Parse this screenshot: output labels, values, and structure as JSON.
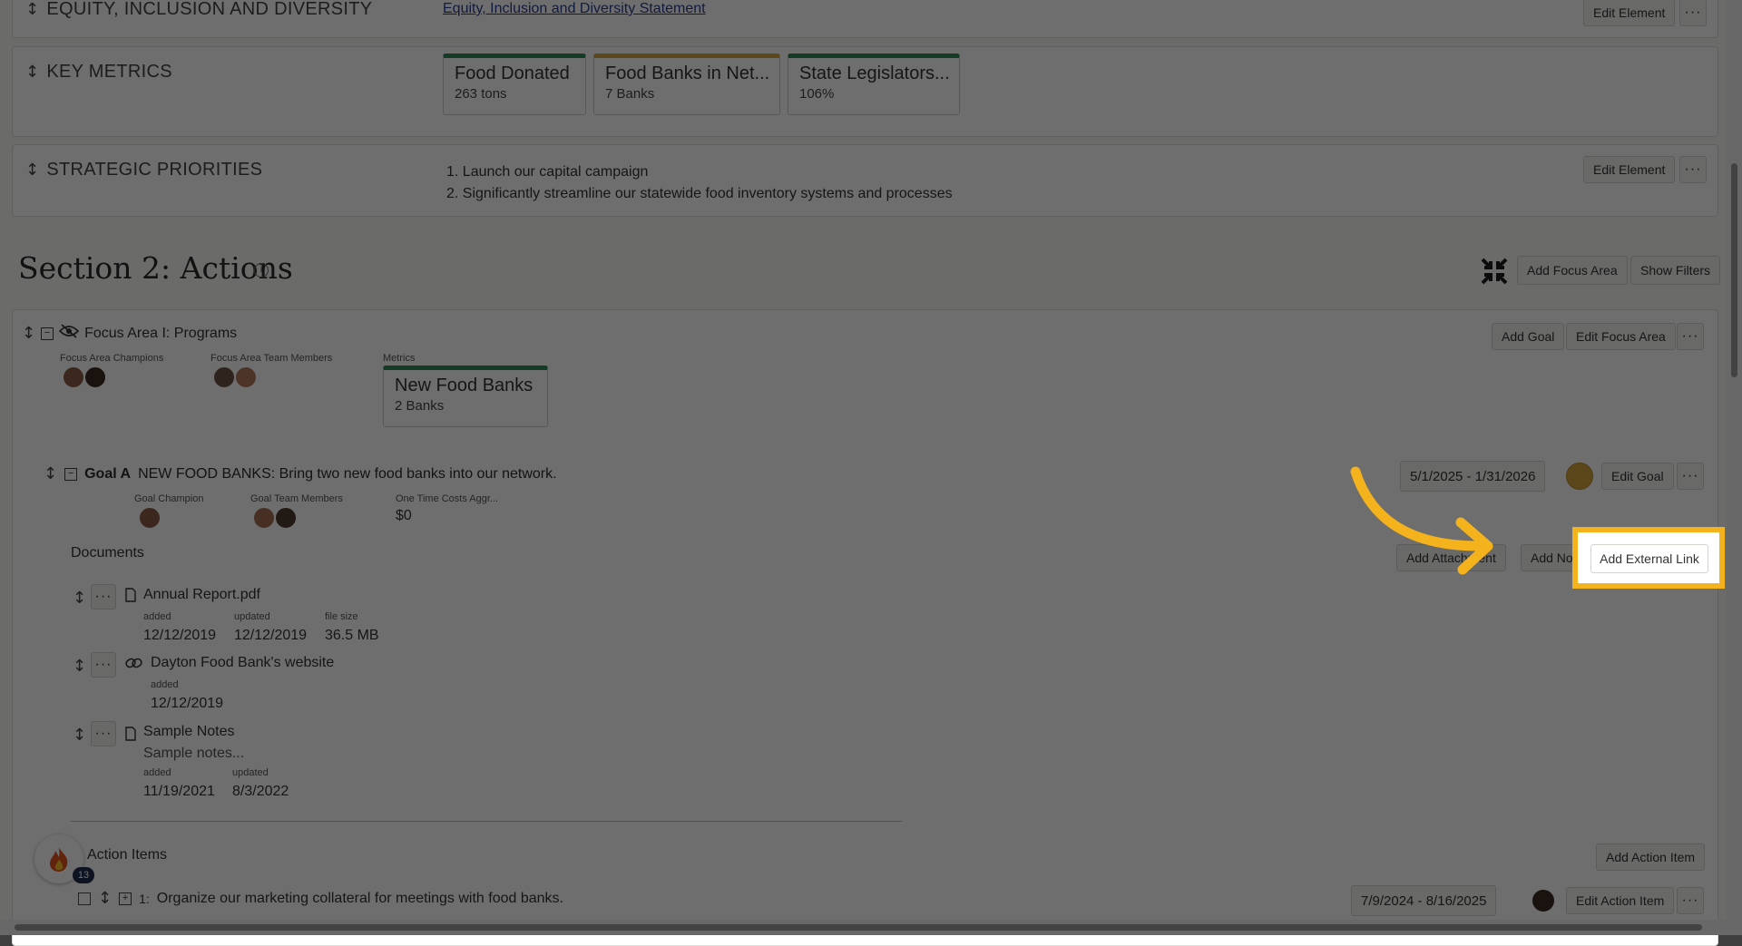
{
  "equity": {
    "label": "EQUITY, INCLUSION AND DIVERSITY",
    "link": "Equity, Inclusion and Diversity Statement",
    "edit": "Edit Element",
    "more": "···"
  },
  "metrics": {
    "label": "KEY METRICS",
    "cards": [
      {
        "title": "Food Donated",
        "value": "263 tons",
        "color": "#2e8b57"
      },
      {
        "title": "Food Banks in Net...",
        "value": "7 Banks",
        "color": "#d4a53a"
      },
      {
        "title": "State Legislators...",
        "value": "106%",
        "color": "#2e8b57"
      }
    ]
  },
  "priorities": {
    "label": "STRATEGIC PRIORITIES",
    "items": [
      "1. Launch our capital campaign",
      "2. Significantly streamline our statewide food inventory systems and processes"
    ],
    "edit": "Edit Element",
    "more": "···"
  },
  "section2": {
    "title": "Section 2: Actions",
    "add_focus": "Add Focus Area",
    "show_filters": "Show Filters"
  },
  "focus": {
    "title": "Focus Area I: Programs",
    "champions_label": "Focus Area Champions",
    "team_label": "Focus Area Team Members",
    "metrics_label": "Metrics",
    "metric_card": {
      "title": "New Food Banks",
      "value": "2 Banks"
    },
    "add_goal": "Add Goal",
    "edit_focus": "Edit Focus Area",
    "more": "···"
  },
  "goal": {
    "tag": "Goal A",
    "title": "NEW FOOD BANKS: Bring two new food banks into our network.",
    "dates": "5/1/2025 - 1/31/2026",
    "edit": "Edit Goal",
    "more": "···",
    "champion_label": "Goal Champion",
    "team_label": "Goal Team Members",
    "cost_label": "One Time Costs Aggr...",
    "cost_value": "$0",
    "documents_label": "Documents",
    "add_attachment": "Add Attachment",
    "add_note": "Add Note",
    "add_external": "Add External Link"
  },
  "docs": [
    {
      "name": "Annual Report.pdf",
      "icon": "file-icon",
      "added_label": "added",
      "added": "12/12/2019",
      "updated_label": "updated",
      "updated": "12/12/2019",
      "size_label": "file size",
      "size": "36.5 MB"
    },
    {
      "name": "Dayton Food Bank's website",
      "icon": "link-icon",
      "added_label": "added",
      "added": "12/12/2019"
    },
    {
      "name": "Sample Notes",
      "icon": "file-icon",
      "preview": "Sample notes...",
      "added_label": "added",
      "added": "11/19/2021",
      "updated_label": "updated",
      "updated": "8/3/2022"
    }
  ],
  "actions": {
    "label": "Action Items",
    "add": "Add Action Item",
    "item_num": "1:",
    "item_text": "Organize our marketing collateral for meetings with food banks.",
    "item_dates": "7/9/2024 - 8/16/2025",
    "edit": "Edit Action Item",
    "more": "···"
  },
  "badge": {
    "count": "13"
  },
  "colors": {
    "accent": "#f4b21d",
    "green": "#2e8b57",
    "gold": "#d4a53a"
  }
}
